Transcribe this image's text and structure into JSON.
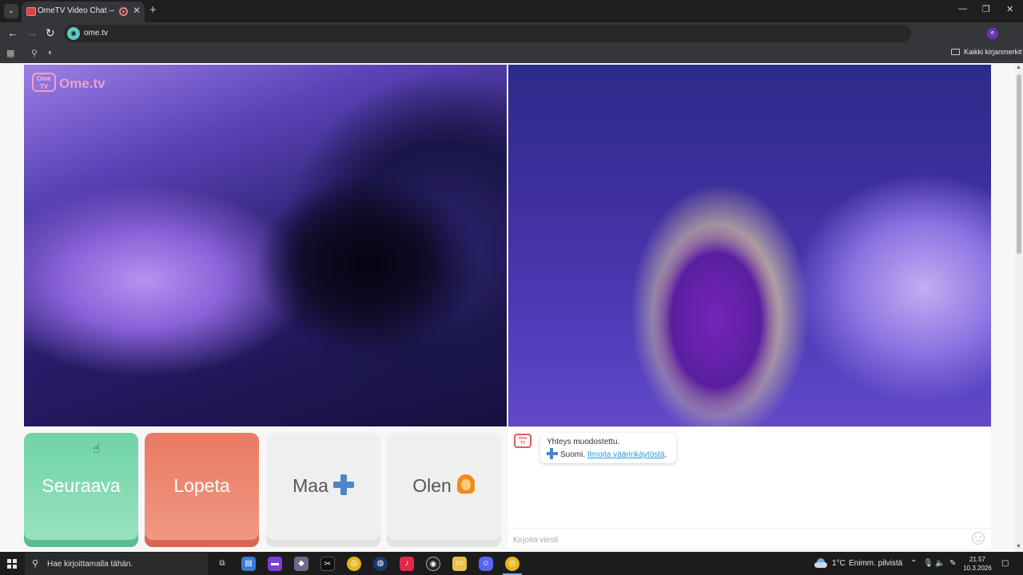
{
  "browser": {
    "tab_title": "OmeTV Video Chat — Ome",
    "tab_close": "✕",
    "new_tab": "+",
    "window_controls": [
      "—",
      "❐",
      "✕"
    ],
    "url": "ome.tv",
    "bookmarks_all_label": "Kaikki kirjanmerkit"
  },
  "page": {
    "logo_tv": "Ome TV",
    "logo_text": "Ome.tv",
    "buttons": {
      "next": "Seuraava",
      "stop": "Lopeta",
      "country": "Maa",
      "gender": "Olen"
    },
    "chat": {
      "logo": "Ome TV",
      "message_line1": "Yhteys muodostettu.",
      "country_name": "Suomi.",
      "report_link": "Ilmoita väärinkäytöstä",
      "report_suffix": ".",
      "input_placeholder": "Kirjoita viesti"
    }
  },
  "taskbar": {
    "search_placeholder": "Hae kirjoittamalla tähän.",
    "weather_temp": "1°C",
    "weather_desc": "Enimm. pilvistä",
    "time": "21.57",
    "date": "10.3.2026",
    "apps": [
      "task-view",
      "microsoft-store",
      "purple-app",
      "gaming-app",
      "capcut",
      "chrome",
      "steam",
      "tiktok",
      "obs",
      "file-explorer",
      "discord",
      "chrome-active"
    ]
  },
  "colors": {
    "next_button": "#6fd3a5",
    "stop_button": "#ea7a63",
    "finland_blue": "#4a86c8",
    "link": "#2a9bd6"
  }
}
